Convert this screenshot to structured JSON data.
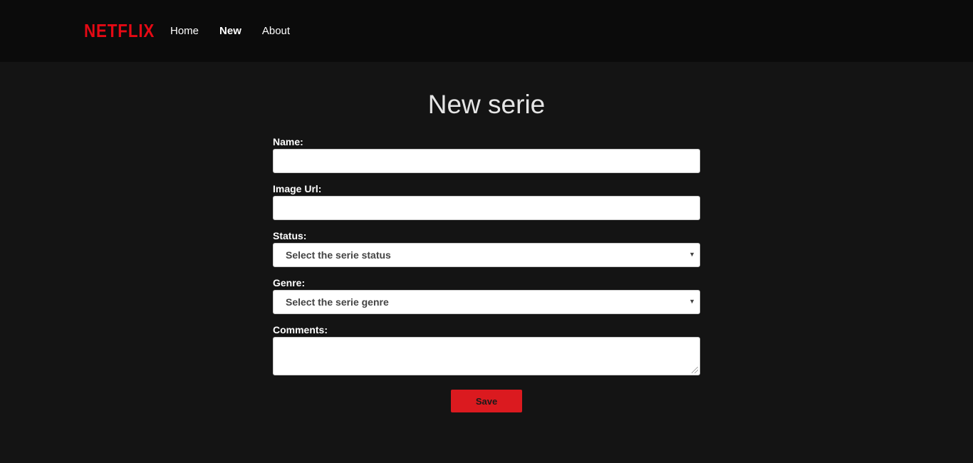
{
  "header": {
    "logo_text": "NETFLIX",
    "nav": [
      {
        "label": "Home"
      },
      {
        "label": "New"
      },
      {
        "label": "About"
      }
    ]
  },
  "page": {
    "title": "New serie"
  },
  "form": {
    "name_label": "Name:",
    "name_value": "",
    "image_url_label": "Image Url:",
    "image_url_value": "",
    "status_label": "Status:",
    "status_selected": "Select the serie status",
    "genre_label": "Genre:",
    "genre_selected": "Select the serie genre",
    "comments_label": "Comments:",
    "comments_value": "",
    "save_label": "Save"
  },
  "colors": {
    "brand": "#e50914",
    "background": "#141414",
    "navbar": "#0b0b0b",
    "button": "#db1a1f"
  },
  "icons": {
    "select_caret": "chevron-down-icon",
    "resize": "resize-handle-icon"
  }
}
